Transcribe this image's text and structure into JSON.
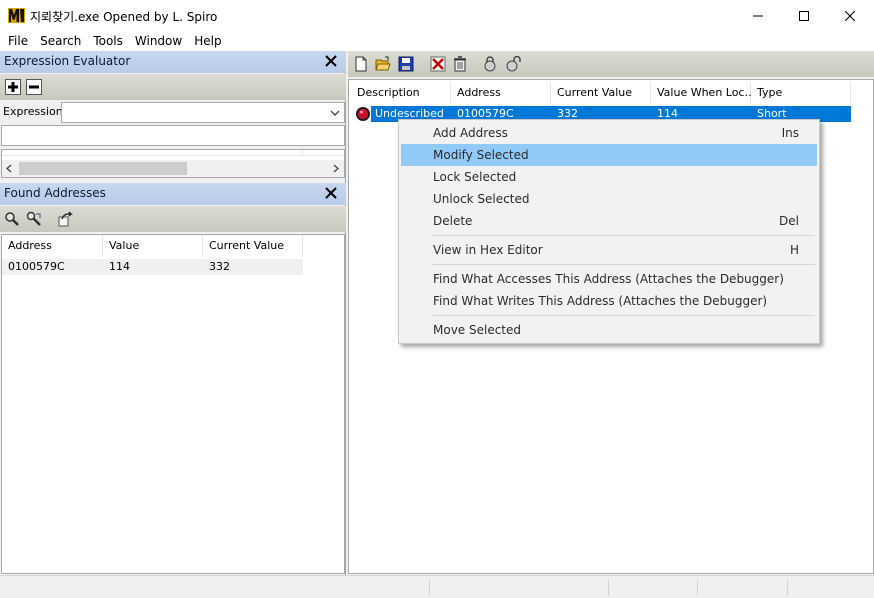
{
  "window": {
    "title": "지뢰찾기.exe Opened by L. Spiro"
  },
  "menu": [
    "File",
    "Search",
    "Tools",
    "Window",
    "Help"
  ],
  "expression_evaluator": {
    "title": "Expression Evaluator",
    "expression_label": "Expression:",
    "expression_value": "",
    "result_value": ""
  },
  "found_addresses": {
    "title": "Found Addresses",
    "columns": [
      "Address",
      "Value",
      "Current Value"
    ],
    "rows": [
      {
        "address": "0100579C",
        "value": "114",
        "current": "332"
      }
    ]
  },
  "address_list": {
    "columns": [
      "Description",
      "Address",
      "Current Value",
      "Value When Loc…",
      "Type"
    ],
    "rows": [
      {
        "description": "Undescribed",
        "address": "0100579C",
        "current": "332",
        "locked": "114",
        "type": "Short"
      }
    ]
  },
  "context_menu": {
    "add_address": {
      "label": "Add Address",
      "shortcut": "Ins"
    },
    "modify_selected": {
      "label": "Modify Selected"
    },
    "lock_selected": {
      "label": "Lock Selected"
    },
    "unlock_selected": {
      "label": "Unlock Selected"
    },
    "delete": {
      "label": "Delete",
      "shortcut": "Del"
    },
    "view_hex": {
      "label": "View in Hex Editor",
      "shortcut": "H"
    },
    "find_accesses": {
      "label": "Find What Accesses This Address (Attaches the Debugger)"
    },
    "find_writes": {
      "label": "Find What Writes This Address (Attaches the Debugger)"
    },
    "move_selected": {
      "label": "Move Selected"
    }
  },
  "colors": {
    "selection": "#0078d7",
    "menu_hover": "#91c9f7",
    "panel_title": "#bfd1ec"
  }
}
